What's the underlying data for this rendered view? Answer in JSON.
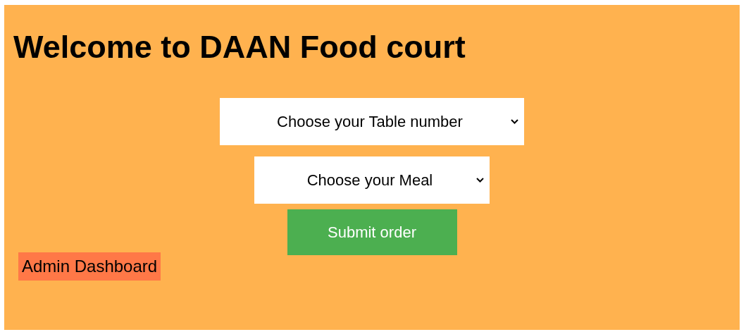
{
  "heading": "Welcome to DAAN Food court",
  "selects": [
    {
      "value": "Choose your Table number"
    },
    {
      "value": "Choose your Meal"
    }
  ],
  "submit_button": "Submit order",
  "admin_link": "Admin Dashboard"
}
